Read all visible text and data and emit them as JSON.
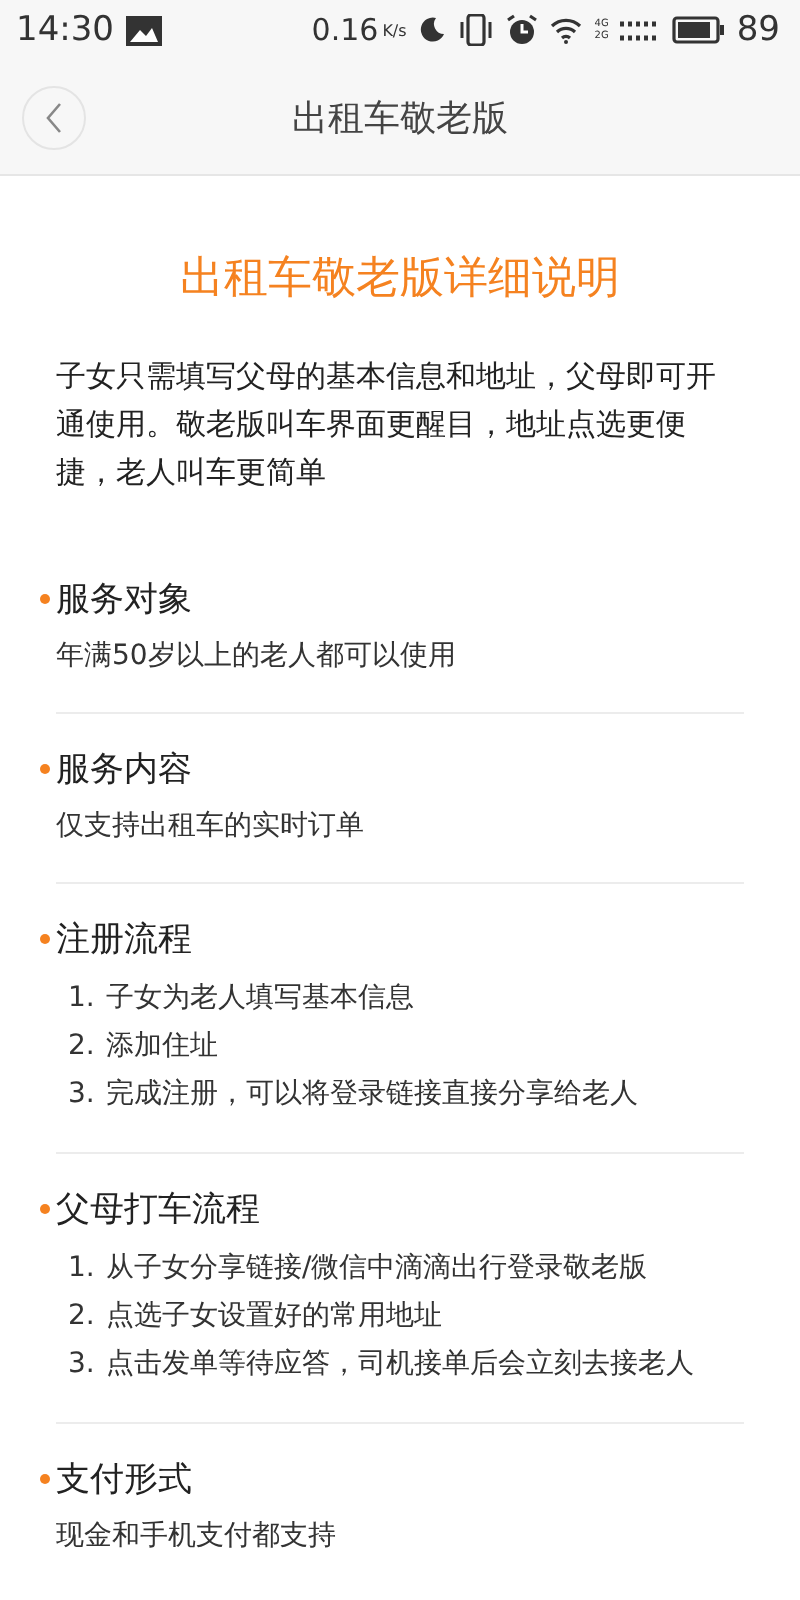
{
  "status_bar": {
    "time": "14:30",
    "speed": "0.16",
    "speed_unit": "K/s",
    "network_top": "4G",
    "network_bottom": "2G",
    "battery": "89"
  },
  "header": {
    "title": "出租车敬老版"
  },
  "article": {
    "title": "出租车敬老版详细说明",
    "intro": "子女只需填写父母的基本信息和地址，父母即可开通使用。敬老版叫车界面更醒目，地址点选更便捷，老人叫车更简单",
    "sections": [
      {
        "heading": "服务对象",
        "kind": "text",
        "text": "年满50岁以上的老人都可以使用"
      },
      {
        "heading": "服务内容",
        "kind": "text",
        "text": "仅支持出租车的实时订单"
      },
      {
        "heading": "注册流程",
        "kind": "steps",
        "steps": [
          {
            "number": "1.",
            "text": "子女为老人填写基本信息"
          },
          {
            "number": "2.",
            "text": "添加住址"
          },
          {
            "number": "3.",
            "text": "完成注册，可以将登录链接直接分享给老人"
          }
        ]
      },
      {
        "heading": "父母打车流程",
        "kind": "steps",
        "steps": [
          {
            "number": "1.",
            "text": "从子女分享链接/微信中滴滴出行登录敬老版"
          },
          {
            "number": "2.",
            "text": "点选子女设置好的常用地址"
          },
          {
            "number": "3.",
            "text": "点击发单等待应答，司机接单后会立刻去接老人"
          }
        ]
      },
      {
        "heading": "支付形式",
        "kind": "text",
        "text": "现金和手机支付都支持"
      }
    ]
  }
}
